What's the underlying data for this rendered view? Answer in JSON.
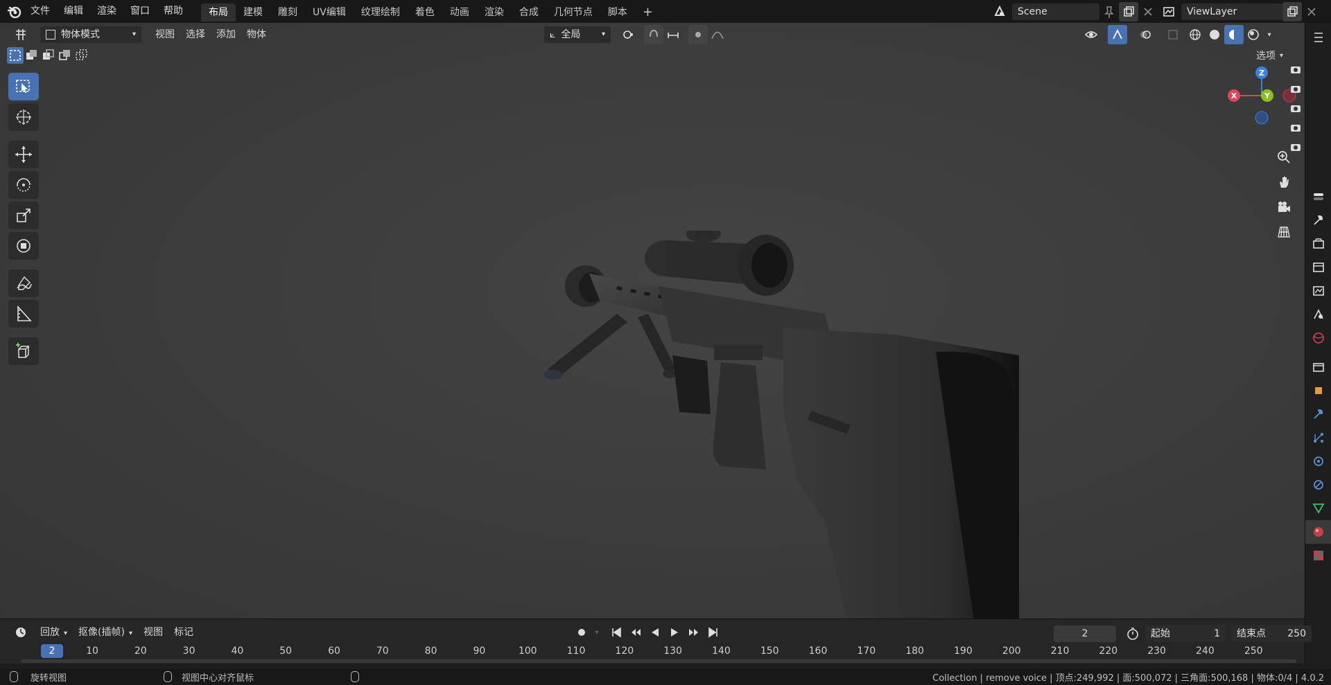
{
  "topbar": {
    "menus": [
      "文件",
      "编辑",
      "渲染",
      "窗口",
      "帮助"
    ],
    "workspaces": [
      "布局",
      "建模",
      "雕刻",
      "UV编辑",
      "纹理绘制",
      "着色",
      "动画",
      "渲染",
      "合成",
      "几何节点",
      "脚本"
    ],
    "active_workspace": "布局",
    "add_workspace": "+",
    "scene_name": "Scene",
    "view_layer": "ViewLayer"
  },
  "viewport_header": {
    "mode": "物体模式",
    "menus": [
      "视图",
      "选择",
      "添加",
      "物体"
    ],
    "transform_orientation": "全局",
    "options_label": "选项"
  },
  "gizmo": {
    "x": "X",
    "y": "Y",
    "z": "Z"
  },
  "timeline": {
    "menus": [
      "回放",
      "抠像(插帧)",
      "视图",
      "标记"
    ],
    "current_frame": "2",
    "start_label": "起始",
    "start_frame": "1",
    "end_label": "结束点",
    "end_frame": "250",
    "ruler_ticks": [
      "10",
      "20",
      "30",
      "40",
      "50",
      "60",
      "70",
      "80",
      "90",
      "100",
      "110",
      "120",
      "130",
      "140",
      "150",
      "160",
      "170",
      "180",
      "190",
      "200",
      "210",
      "220",
      "230",
      "240",
      "250"
    ],
    "playhead": "2"
  },
  "statusbar": {
    "left_hint": "旋转视图",
    "middle_hint": "视图中心对齐鼠标",
    "stats": "Collection | remove voice | 顶点:249,992 | 面:500,072 | 三角面:500,168 | 物体:0/4 | 4.0.2"
  },
  "colors": {
    "accent": "#4772b3",
    "axis_x": "#e0435a",
    "axis_y": "#88c020",
    "axis_z": "#3b82d9",
    "viewport_bg": "#3d3d3d",
    "header_bg": "#181818"
  },
  "icons": {
    "left_tools": [
      "select-box-icon",
      "cursor-icon",
      "move-icon",
      "rotate-icon",
      "scale-icon",
      "transform-icon",
      "annotate-icon",
      "measure-icon",
      "add-cube-icon"
    ],
    "nav": [
      "zoom-icon",
      "hand-pan-icon",
      "camera-icon",
      "grid-ortho-icon"
    ],
    "properties": [
      "tool-icon",
      "render-icon",
      "output-icon",
      "view-layer-icon",
      "scene-icon",
      "world-icon",
      "collection-icon",
      "object-icon",
      "modifier-icon",
      "particles-icon",
      "physics-icon",
      "constraints-icon",
      "data-icon",
      "material-icon",
      "texture-icon"
    ]
  }
}
